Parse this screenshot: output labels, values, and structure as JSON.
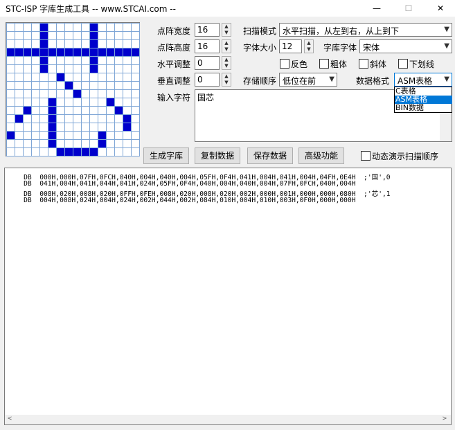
{
  "window": {
    "title": "STC-ISP 字库生成工具 -- www.STCAI.com --",
    "minimize": "—",
    "maximize": "☐",
    "close": "✕"
  },
  "grid": {
    "size": 16,
    "rows": [
      "0000000000000000",
      "0000000000000000",
      "0000000000000000",
      "0000000000000000",
      "0000000000000000",
      "0000000000000000",
      "0000000000000000",
      "0000000000000000",
      "0000000000000000",
      "0000000000000000",
      "0000000000000000",
      "0000000000000000",
      "0000000000000000",
      "0000000000000000",
      "0000000000000000",
      "0000000000000000"
    ],
    "on": [
      [
        0,
        4
      ],
      [
        1,
        4
      ],
      [
        2,
        4
      ],
      [
        3,
        0
      ],
      [
        3,
        1
      ],
      [
        3,
        2
      ],
      [
        3,
        3
      ],
      [
        3,
        4
      ],
      [
        3,
        5
      ],
      [
        3,
        6
      ],
      [
        3,
        7
      ],
      [
        3,
        8
      ],
      [
        3,
        9
      ],
      [
        3,
        10
      ],
      [
        3,
        11
      ],
      [
        3,
        12
      ],
      [
        3,
        13
      ],
      [
        3,
        14
      ],
      [
        3,
        15
      ],
      [
        0,
        10
      ],
      [
        1,
        10
      ],
      [
        2,
        10
      ],
      [
        4,
        4
      ],
      [
        4,
        10
      ],
      [
        5,
        4
      ],
      [
        5,
        10
      ],
      [
        6,
        6
      ],
      [
        7,
        7
      ],
      [
        8,
        8
      ],
      [
        9,
        5
      ],
      [
        9,
        12
      ],
      [
        10,
        2
      ],
      [
        10,
        5
      ],
      [
        10,
        13
      ],
      [
        11,
        1
      ],
      [
        11,
        5
      ],
      [
        11,
        14
      ],
      [
        12,
        5
      ],
      [
        12,
        14
      ],
      [
        13,
        0
      ],
      [
        13,
        5
      ],
      [
        13,
        11
      ],
      [
        14,
        5
      ],
      [
        14,
        11
      ],
      [
        15,
        6
      ],
      [
        15,
        7
      ],
      [
        15,
        8
      ],
      [
        15,
        9
      ],
      [
        15,
        10
      ]
    ]
  },
  "settings": {
    "width_label": "点阵宽度",
    "width_value": "16",
    "height_label": "点阵高度",
    "height_value": "16",
    "hadj_label": "水平调整",
    "hadj_value": "0",
    "vadj_label": "垂直调整",
    "vadj_value": "0",
    "scan_label": "扫描模式",
    "scan_value": "水平扫描，从左到右，从上到下",
    "fontsize_label": "字体大小",
    "fontsize_value": "12",
    "font_label": "字库字体",
    "font_value": "宋体",
    "invert_label": "反色",
    "bold_label": "粗体",
    "italic_label": "斜体",
    "underline_label": "下划线",
    "order_label": "存储顺序",
    "order_value": "低位在前",
    "format_label": "数据格式",
    "format_value": "ASM表格",
    "input_label": "输入字符",
    "input_value": "国芯"
  },
  "format_options": [
    "C表格",
    "ASM表格",
    "BIN数据"
  ],
  "format_selected_index": 1,
  "buttons": {
    "generate": "生成字库",
    "copy": "复制数据",
    "save": "保存数据",
    "advanced": "高级功能",
    "demo_label": "动态演示扫描顺序"
  },
  "output_lines": [
    "    DB  000H,000H,07FH,0FCH,040H,004H,040H,004H,05FH,0F4H,041H,004H,041H,004H,04FH,0E4H  ;'国',0",
    "    DB  041H,004H,041H,044H,041H,024H,05FH,0F4H,040H,004H,040H,004H,07FH,0FCH,040H,004H",
    "    DB  008H,020H,008H,020H,0FFH,0FEH,008H,020H,008H,020H,002H,000H,001H,000H,000H,080H  ;'芯',1",
    "    DB  004H,008H,024H,004H,024H,002H,044H,002H,084H,010H,004H,010H,003H,0F0H,000H,000H"
  ],
  "scroll": {
    "left": "<",
    "right": ">"
  }
}
